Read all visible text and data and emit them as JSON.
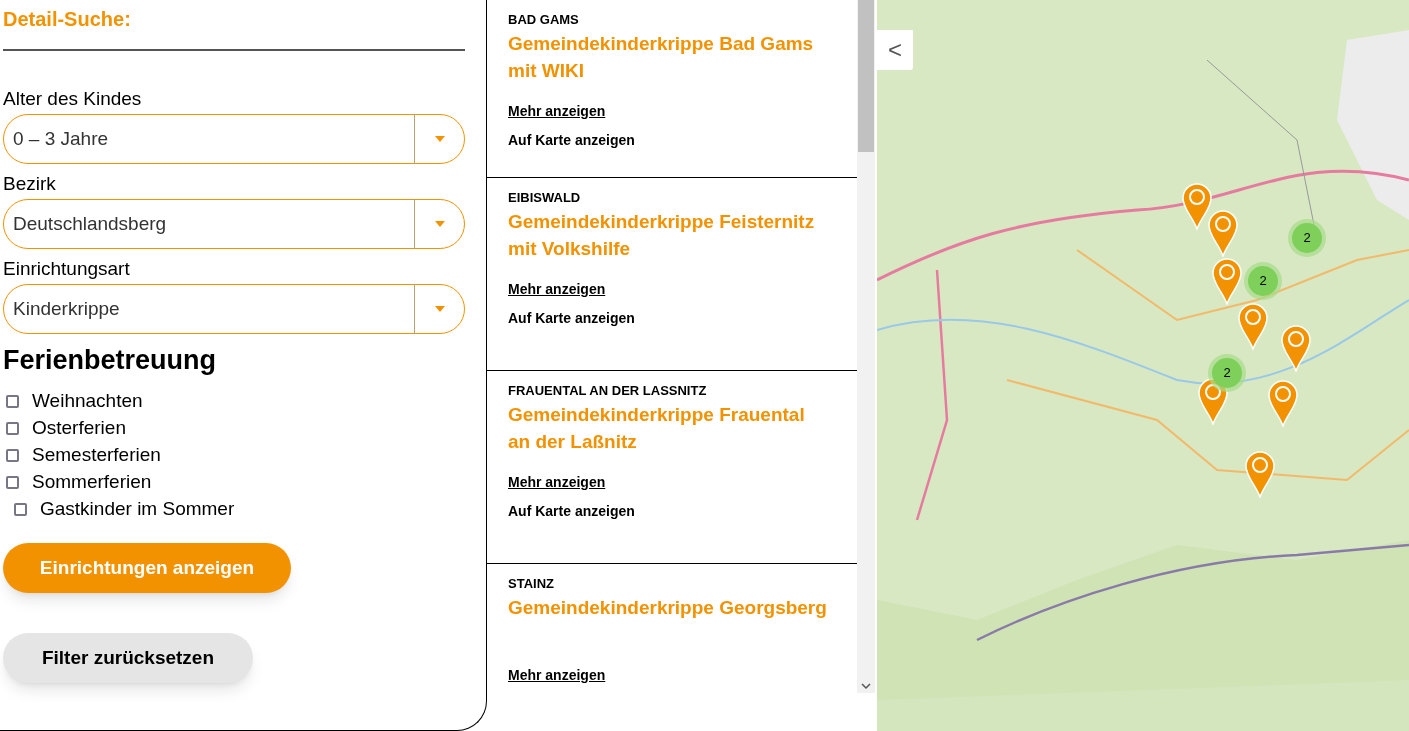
{
  "search": {
    "title": "Detail-Suche:",
    "selects": [
      {
        "label": "Alter des Kindes",
        "value": "0 – 3 Jahre"
      },
      {
        "label": "Bezirk",
        "value": "Deutschlandsberg"
      },
      {
        "label": "Einrichtungsart",
        "value": "Kinderkrippe"
      }
    ],
    "holiday_title": "Ferienbetreuung",
    "holidays": [
      {
        "label": "Weihnachten",
        "checked": false
      },
      {
        "label": "Osterferien",
        "checked": false
      },
      {
        "label": "Semesterferien",
        "checked": false
      },
      {
        "label": "Sommerferien",
        "checked": false
      }
    ],
    "guest": {
      "label": "Gastkinder im Sommer",
      "checked": false
    },
    "submit": "Einrichtungen anzeigen",
    "reset": "Filter zurücksetzen"
  },
  "results": [
    {
      "place": "BAD GAMS",
      "name": "Gemeindekinderkrippe Bad Gams mit WIKI",
      "more": "Mehr anzeigen",
      "map": "Auf Karte anzeigen"
    },
    {
      "place": "EIBISWALD",
      "name": "Gemeindekinderkrippe Feisternitz mit Volkshilfe",
      "more": "Mehr anzeigen",
      "map": "Auf Karte anzeigen"
    },
    {
      "place": "FRAUENTAL AN DER LASSNITZ",
      "name": "Gemeindekinderkrippe Frauental an der Laßnitz",
      "more": "Mehr anzeigen",
      "map": "Auf Karte anzeigen"
    },
    {
      "place": "STAINZ",
      "name": "Gemeindekinderkrippe Georgsberg",
      "more": "Mehr anzeigen"
    }
  ],
  "map": {
    "collapse": "<",
    "markers": [
      {
        "kind": "pin"
      },
      {
        "kind": "pin"
      },
      {
        "kind": "cluster",
        "count": "2"
      },
      {
        "kind": "pin"
      },
      {
        "kind": "cluster",
        "count": "2"
      },
      {
        "kind": "pin"
      },
      {
        "kind": "pin"
      },
      {
        "kind": "cluster",
        "count": "2"
      },
      {
        "kind": "pin"
      },
      {
        "kind": "pin"
      },
      {
        "kind": "pin"
      }
    ]
  }
}
